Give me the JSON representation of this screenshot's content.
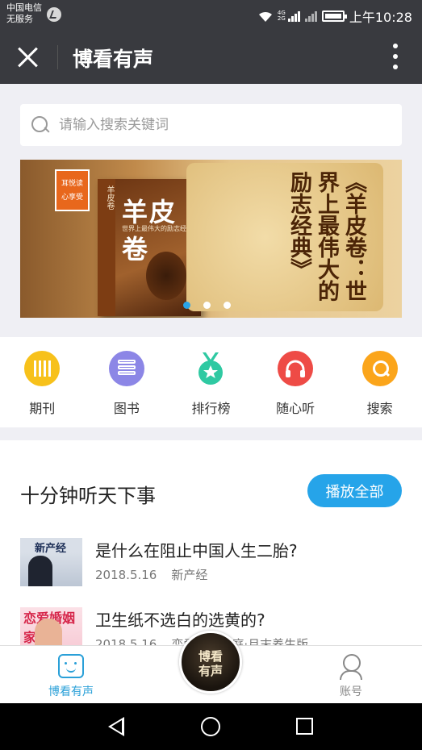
{
  "status_bar": {
    "carrier_line1": "中国电信",
    "carrier_line2": "无服务",
    "net_tag1": "4G",
    "net_tag2": "2G",
    "time": "上午10:28"
  },
  "titlebar": {
    "title": "博看有声"
  },
  "search": {
    "placeholder": "请输入搜索关键词"
  },
  "banner": {
    "tag_line1": "耳悦读",
    "tag_line2": "心享受",
    "book_title": "羊皮卷",
    "book_subtitle": "世界上最伟大的励志经典",
    "headline": "《羊皮卷：世界上最伟大的励志经典》",
    "slide_count": 3,
    "active_slide": 1
  },
  "nav": {
    "items": [
      {
        "label": "期刊",
        "icon": "journal-icon",
        "color": "#f7c11b"
      },
      {
        "label": "图书",
        "icon": "books-icon",
        "color": "#8c86e6"
      },
      {
        "label": "排行榜",
        "icon": "medal-icon",
        "color": "#2fc9a2"
      },
      {
        "label": "随心听",
        "icon": "headphones-icon",
        "color": "#ee4b46"
      },
      {
        "label": "搜索",
        "icon": "search-icon",
        "color": "#fba51b"
      }
    ]
  },
  "section": {
    "title": "十分钟听天下事",
    "play_all": "播放全部",
    "articles": [
      {
        "title": "是什么在阻止中国人生二胎?",
        "date": "2018.5.16",
        "source": "新产经",
        "thumb_text": "新产经"
      },
      {
        "title": "卫生纸不选白的选黄的?",
        "date": "2018.5.16",
        "source": "恋爱婚姻家庭·月末养生版",
        "thumb_text": "恋爱婚姻家庭"
      }
    ]
  },
  "tabbar": {
    "home_label": "博看有声",
    "center_line1": "博看",
    "center_line2": "有声",
    "account_label": "账号"
  },
  "colors": {
    "accent": "#26a4e9",
    "header_bg": "#393a3f"
  }
}
